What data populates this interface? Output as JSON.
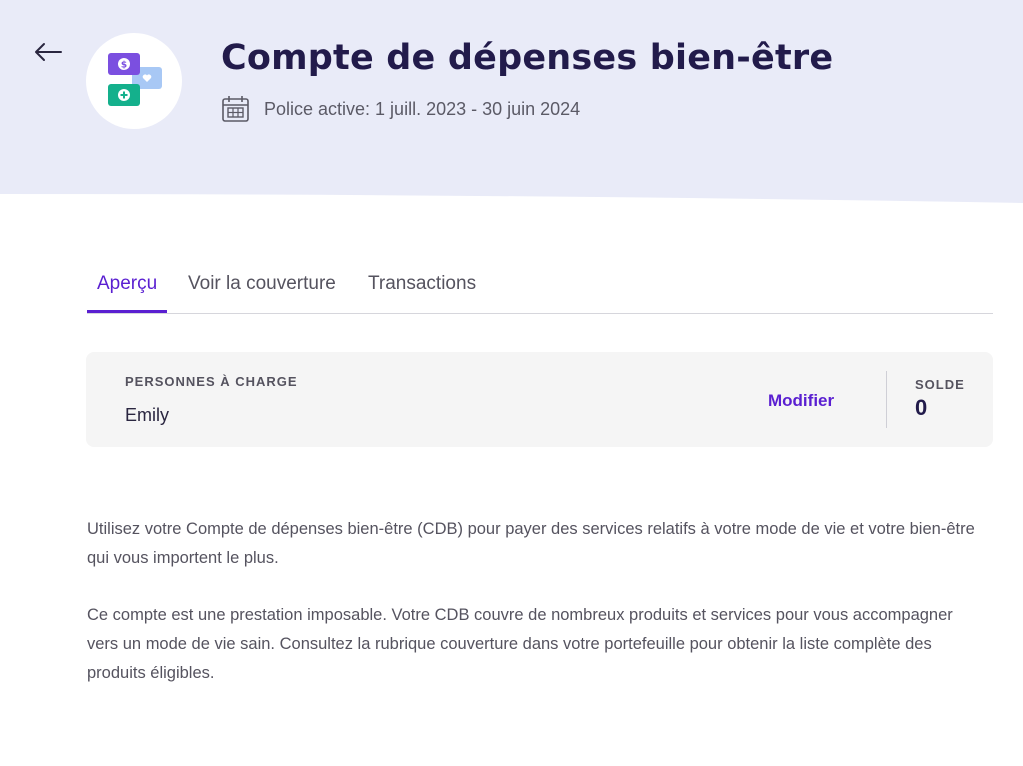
{
  "header": {
    "title": "Compte de dépenses bien-être",
    "policy_text": "Police active: 1 juill. 2023 - 30 juin 2024",
    "background_color": "#e9ebf8",
    "icons": {
      "back": "arrow-left-icon",
      "logo": "wellness-account-logo",
      "calendar": "calendar-icon"
    }
  },
  "tabs": [
    {
      "label": "Aperçu",
      "active": true
    },
    {
      "label": "Voir la couverture",
      "active": false
    },
    {
      "label": "Transactions",
      "active": false
    }
  ],
  "summary_card": {
    "dependents_label": "PERSONNES À CHARGE",
    "dependents_value": "Emily",
    "edit_label": "Modifier",
    "balance_label": "SOLDE",
    "balance_value": "0"
  },
  "description": [
    "Utilisez votre Compte de dépenses bien-être (CDB) pour payer des services relatifs à votre mode de vie et votre bien-être qui vous importent le plus.",
    "Ce compte est une prestation imposable. Votre CDB couvre de nombreux produits et services pour vous accompagner vers un mode de vie sain. Consultez la rubrique couverture dans votre portefeuille pour obtenir la liste complète des produits éligibles."
  ],
  "colors": {
    "accent": "#5a1fd1",
    "title": "#221b4b",
    "logo_purple": "#7b4fe0",
    "logo_green": "#14b08c",
    "logo_lightblue": "#a8c8f5"
  }
}
